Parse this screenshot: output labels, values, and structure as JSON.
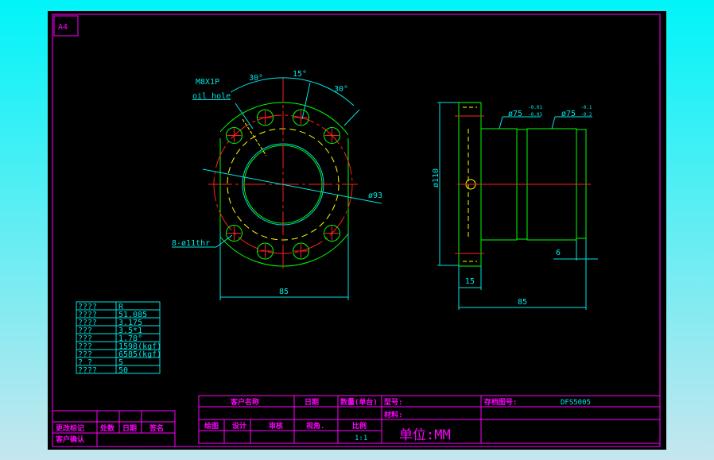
{
  "sheet": {
    "size_label": "A4"
  },
  "front_view": {
    "oil_hole_thread": "M8X1P",
    "oil_hole_label": "oil hole",
    "angle_left": "30°",
    "angle_mid": "15°",
    "angle_right": "30°",
    "pcd_label": "ø93",
    "holes_label": "8-ø11thr",
    "width_dim": "85"
  },
  "side_view": {
    "dia_fit": "ø75",
    "dia_fit_tol_upper": "-0.01",
    "dia_fit_tol_lower": "-0.03",
    "dia_body": "ø75",
    "dia_body_tol_upper": "-0.1",
    "dia_body_tol_lower": "-0.2",
    "flange_dia": "ø110",
    "flange_thickness": "15",
    "length": "85",
    "end_width": "6"
  },
  "spec_table": {
    "rows": [
      {
        "label": "????",
        "value": "R"
      },
      {
        "label": "????",
        "value": "51.085"
      },
      {
        "label": "????",
        "value": "3.175"
      },
      {
        "label": " ???",
        "value": "3.5*1"
      },
      {
        "label": " ???",
        "value": "1.78°"
      },
      {
        "label": " ???",
        "value": "1598(kgf)"
      },
      {
        "label": " ???",
        "value": "6585(kgf)"
      },
      {
        "label": " ?  ?",
        "value": "5"
      },
      {
        "label": "????",
        "value": "50"
      }
    ]
  },
  "revision_table": {
    "change_mark": "更改标记",
    "count": "处数",
    "date": "日期",
    "signature": "签名",
    "customer_confirm": "客户确认"
  },
  "title_block": {
    "customer_name": "客户名称",
    "date": "日期",
    "quantity": "数量(单台)",
    "model": "型号:",
    "drawing_no_label": "存档图号:",
    "drawing_no": "DFS5005",
    "material": "材料:",
    "drawn": "绘图",
    "design": "设计",
    "review": "审核",
    "view_angle": "视角.",
    "scale_label": "比例",
    "scale": "1:1",
    "unit": "单位:MM"
  }
}
